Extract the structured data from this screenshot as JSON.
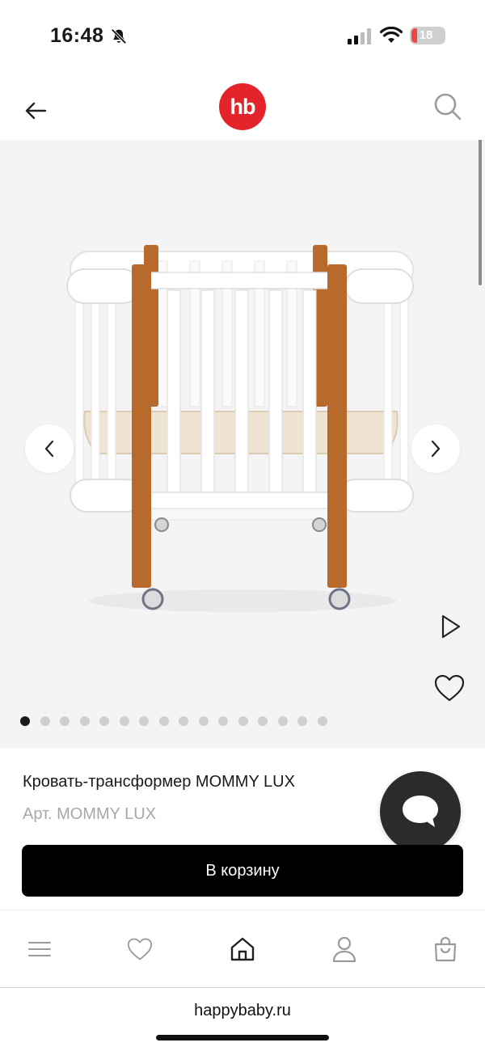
{
  "status_bar": {
    "time": "16:48",
    "battery": "18",
    "icons": [
      "bell-off-icon",
      "signal-icon",
      "wifi-icon",
      "battery-icon"
    ]
  },
  "header": {
    "logo_text": "hb",
    "back_icon": "arrow-left-icon",
    "search_icon": "search-icon",
    "brand_color": "#e4242b"
  },
  "gallery": {
    "image": "baby-crib-transformer",
    "slide_count": 16,
    "active_slide": 1,
    "icons": [
      "chevron-left-icon",
      "chevron-right-icon",
      "play-icon",
      "heart-icon"
    ]
  },
  "product": {
    "name": "Кровать-трансформер MOMMY LUX",
    "sku": "Арт. MOMMY LUX",
    "cart_label": "В корзину"
  },
  "chat": {
    "icon": "chat-bubble-icon"
  },
  "bottom_nav": {
    "items": [
      "menu-icon",
      "heart-icon",
      "home-icon",
      "user-icon",
      "bag-icon"
    ],
    "active": "home-icon"
  },
  "browser": {
    "url": "happybaby.ru"
  }
}
